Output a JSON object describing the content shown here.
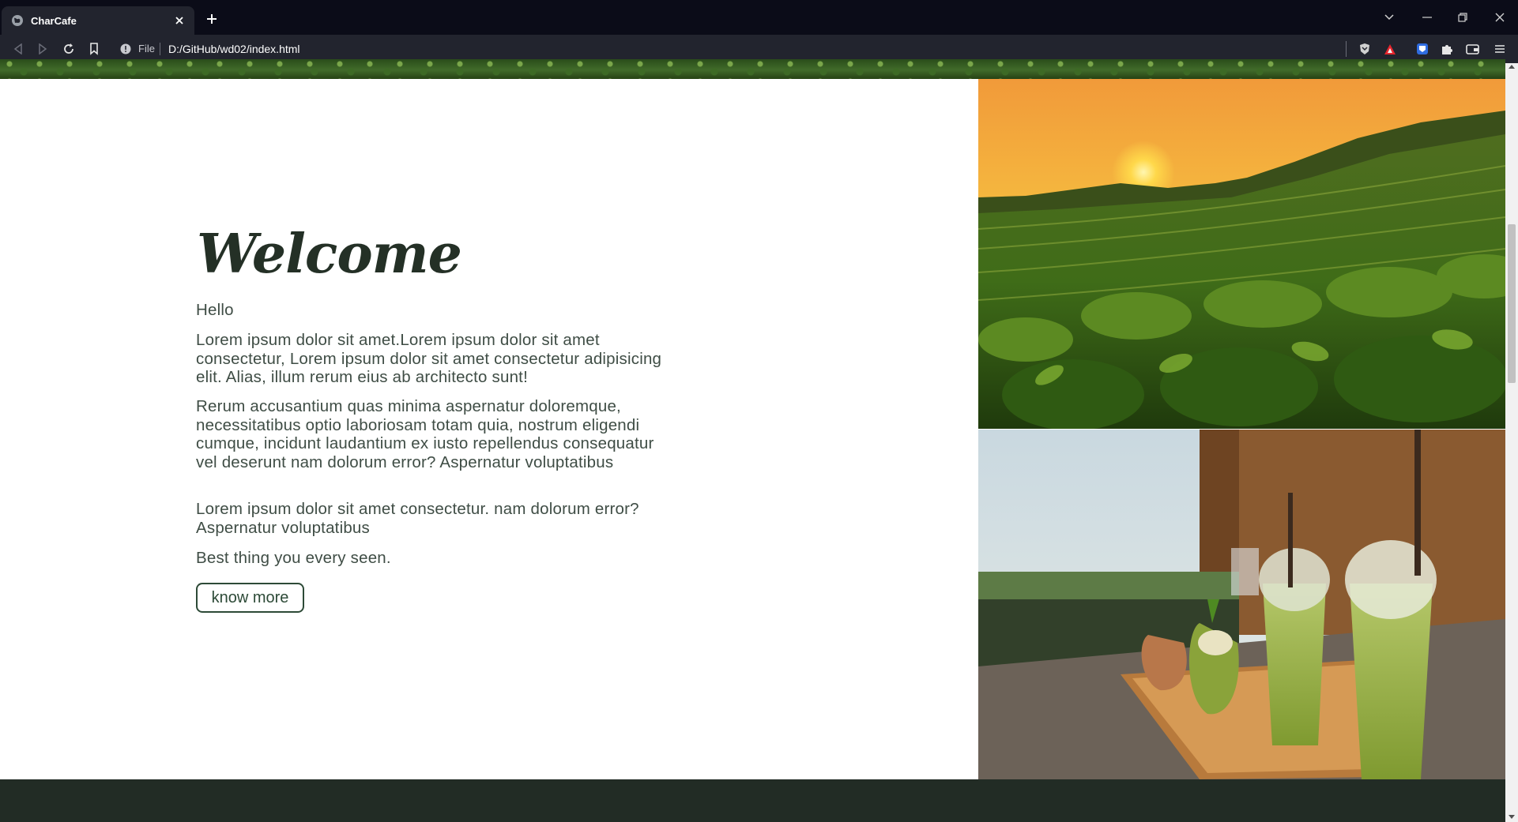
{
  "browser": {
    "tab_title": "CharCafe",
    "file_label": "File",
    "url": "D:/GitHub/wd02/index.html"
  },
  "page": {
    "heading": "Welcome",
    "paragraphs": [
      "Hello",
      "Lorem ipsum dolor sit amet.Lorem ipsum dolor sit amet consectetur, Lorem ipsum dolor sit amet consectetur adipisicing elit. Alias, illum rerum eius ab architecto sunt!",
      "Rerum accusantium quas minima aspernatur doloremque, necessitatibus optio laboriosam totam quia, nostrum eligendi cumque, incidunt laudantium ex iusto repellendus consequatur vel deserunt nam dolorum error? Aspernatur voluptatibus",
      "Lorem ipsum dolor sit amet consectetur. nam dolorum error? Aspernatur voluptatibus",
      "Best thing you every seen."
    ],
    "button_label": "know more"
  },
  "colors": {
    "heading": "#243026",
    "body_text": "#3f4d45",
    "button_border": "#2d4a37",
    "footer": "#222c25",
    "chrome_dark": "#0b0c18",
    "chrome_toolbar": "#22242e"
  },
  "icons": [
    "globe-icon",
    "close-icon",
    "plus-icon",
    "chevron-down-icon",
    "minimize-icon",
    "restore-icon",
    "back-icon",
    "forward-icon",
    "reload-icon",
    "bookmark-icon",
    "info-icon",
    "brave-shield-icon",
    "brave-rewards-icon",
    "bitwarden-icon",
    "extensions-icon",
    "wallet-icon",
    "menu-icon"
  ]
}
